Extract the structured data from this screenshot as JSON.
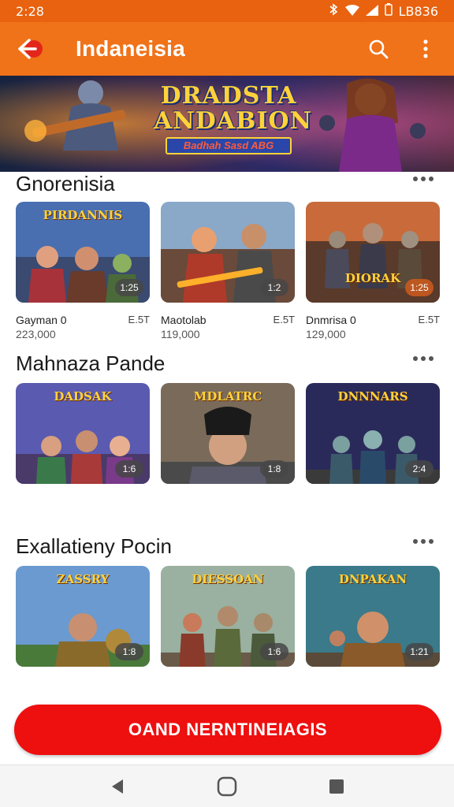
{
  "status_bar": {
    "time": "2:28",
    "battery_text": "LB836"
  },
  "app_bar": {
    "title": "Indaneisia"
  },
  "banner": {
    "title_line1": "DRADSTA",
    "title_line2": "ANDABION",
    "subtitle": "Badhah Sasd ABG"
  },
  "sections": [
    {
      "title": "Gnorenisia",
      "games": [
        {
          "art_title": "PIRDANNIS",
          "badge": "1:25",
          "name": "Gayman 0",
          "rating": "E.5T",
          "count": "223,000"
        },
        {
          "art_title": "",
          "badge": "1:2",
          "name": "Maotolab",
          "rating": "E.5T",
          "count": "119,000"
        },
        {
          "art_title": "DIORAK",
          "badge": "1:25",
          "name": "Dnmrisa 0",
          "rating": "E.5T",
          "count": "129,000"
        }
      ]
    },
    {
      "title": "Mahnaza Pande",
      "games": [
        {
          "art_title": "DADSAK",
          "badge": "1:6"
        },
        {
          "art_title": "MDLATRC",
          "badge": "1:8"
        },
        {
          "art_title": "DNNNARS",
          "badge": "2:4"
        }
      ]
    },
    {
      "title": "Exallatieny Pocin",
      "games": [
        {
          "art_title": "ZASSRY",
          "badge": "1:8"
        },
        {
          "art_title": "DIESSOAN",
          "badge": "1:6"
        },
        {
          "art_title": "DNPAKAN",
          "badge": "1:21"
        }
      ]
    }
  ],
  "cta": {
    "label": "OAND NERNTINEIAGIS"
  },
  "colors": {
    "app_bar": "#f07219",
    "status_bar": "#e8620f",
    "cta": "#ee0f0f",
    "art_title": "#ffd23a"
  }
}
